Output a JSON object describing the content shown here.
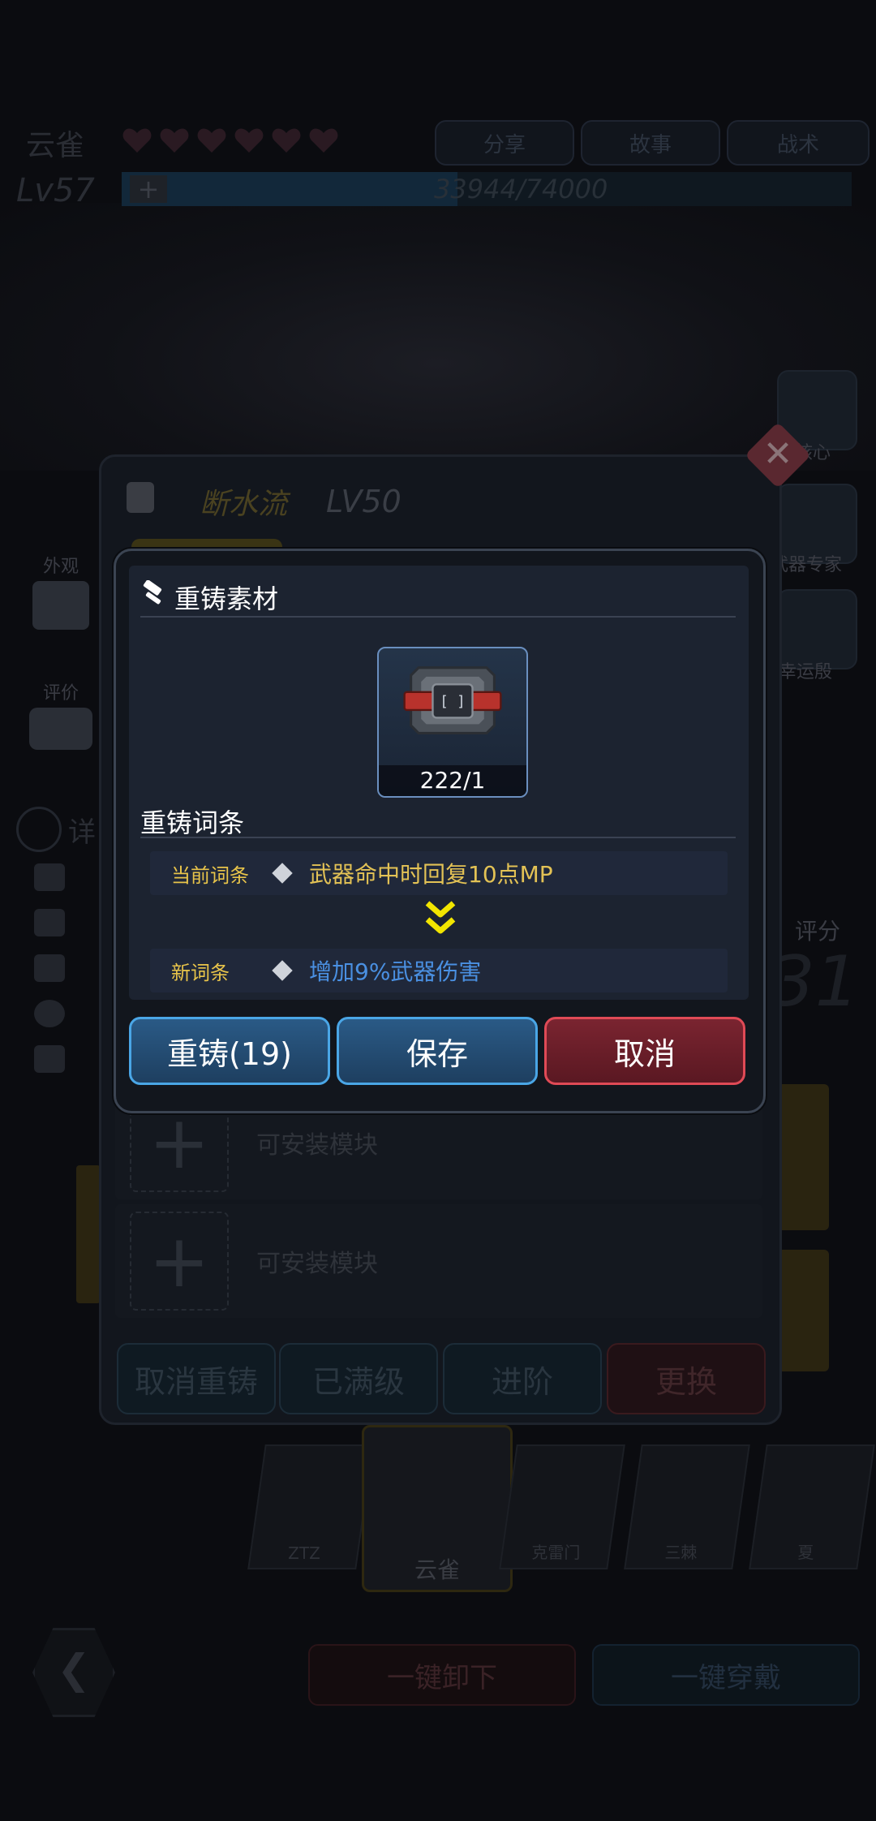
{
  "hero": {
    "name": "云雀",
    "level": "Lv57",
    "exp": "33944/74000",
    "hearts": 6
  },
  "top_buttons": [
    "分享",
    "故事",
    "战术"
  ],
  "side_left": {
    "appearance": "外观",
    "rating": "评价",
    "detail": "详"
  },
  "side_right": [
    "核心",
    "武器专家",
    "幸运殷"
  ],
  "score_label": "评分",
  "score_value": "31",
  "weapon": {
    "name": "断水流",
    "level": "LV50"
  },
  "modules": {
    "slot_label": "可安装模块"
  },
  "panel_buttons": [
    "取消重铸",
    "已满级",
    "进阶",
    "更换"
  ],
  "characters": [
    "ZTZ",
    "云雀",
    "克雷门",
    "三棘",
    "夏"
  ],
  "footer_buttons": [
    "一键卸下",
    "一键穿戴"
  ],
  "dialog": {
    "material_title": "重铸素材",
    "item_count": "222/1",
    "reforge_title": "重铸词条",
    "current_label": "当前词条",
    "current_value": "武器命中时回复10点MP",
    "new_label": "新词条",
    "new_value": "增加9%武器伤害",
    "btn_reforge": "重铸(19)",
    "btn_save": "保存",
    "btn_cancel": "取消"
  },
  "colors": {
    "accent_blue": "#4aa6e6",
    "accent_red": "#e04a56",
    "gold_text": "#e3c255",
    "new_value_blue": "#4a90e2",
    "arrow_yellow": "#f2e500"
  }
}
